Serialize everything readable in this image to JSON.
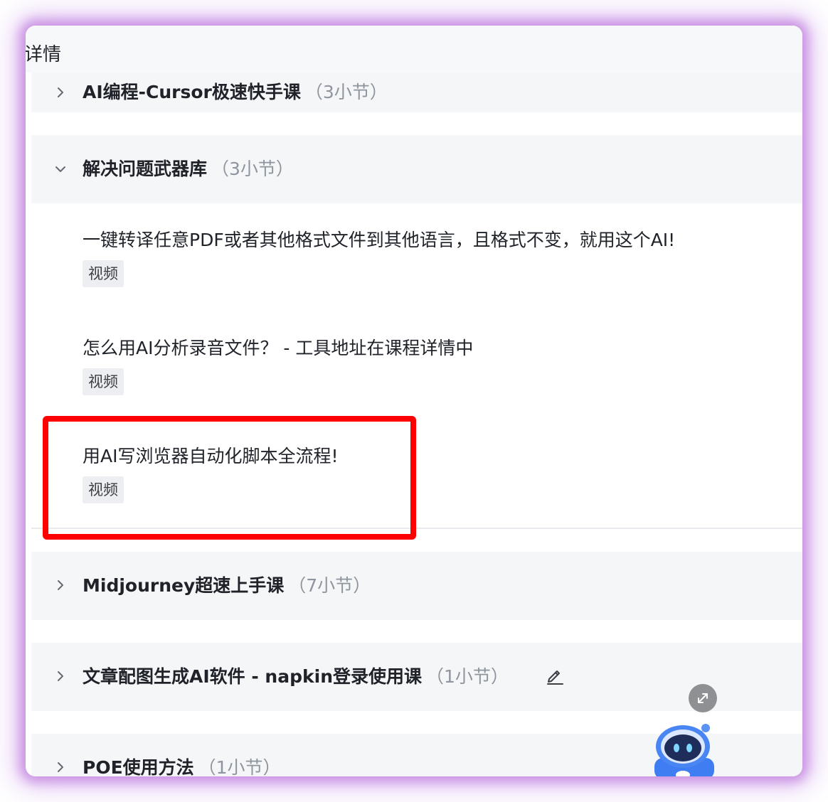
{
  "header": {
    "title": "详情"
  },
  "chapters": [
    {
      "title": "AI编程-Cursor极速快手课",
      "count": "（3小节）",
      "expanded": false,
      "icon": "chevron-right-icon"
    },
    {
      "title": "解决问题武器库",
      "count": "（3小节）",
      "expanded": true,
      "icon": "chevron-down-icon",
      "lessons": [
        {
          "title": "一键转译任意PDF或者其他格式文件到其他语言，且格式不变，就用这个AI!",
          "tag": "视频"
        },
        {
          "title": "怎么用AI分析录音文件？ - 工具地址在课程详情中",
          "tag": "视频"
        },
        {
          "title": "用AI写浏览器自动化脚本全流程!",
          "tag": "视频"
        }
      ]
    },
    {
      "title": "Midjourney超速上手课",
      "count": "（7小节）",
      "expanded": false,
      "icon": "chevron-right-icon"
    },
    {
      "title": "文章配图生成AI软件 - napkin登录使用课",
      "count": "（1小节）",
      "expanded": false,
      "icon": "chevron-right-icon"
    },
    {
      "title": "POE使用方法",
      "count": "（1小节）",
      "expanded": false,
      "icon": "chevron-right-icon"
    }
  ],
  "icons": {
    "edit": "edit-icon",
    "expand": "expand-icon",
    "assistant": "robot-assistant-icon"
  },
  "colors": {
    "highlight": "#ff0000",
    "glow": "#c07fdc",
    "chapter_bg": "#f5f6f8",
    "text": "#1f2329",
    "muted": "#8f959e"
  }
}
